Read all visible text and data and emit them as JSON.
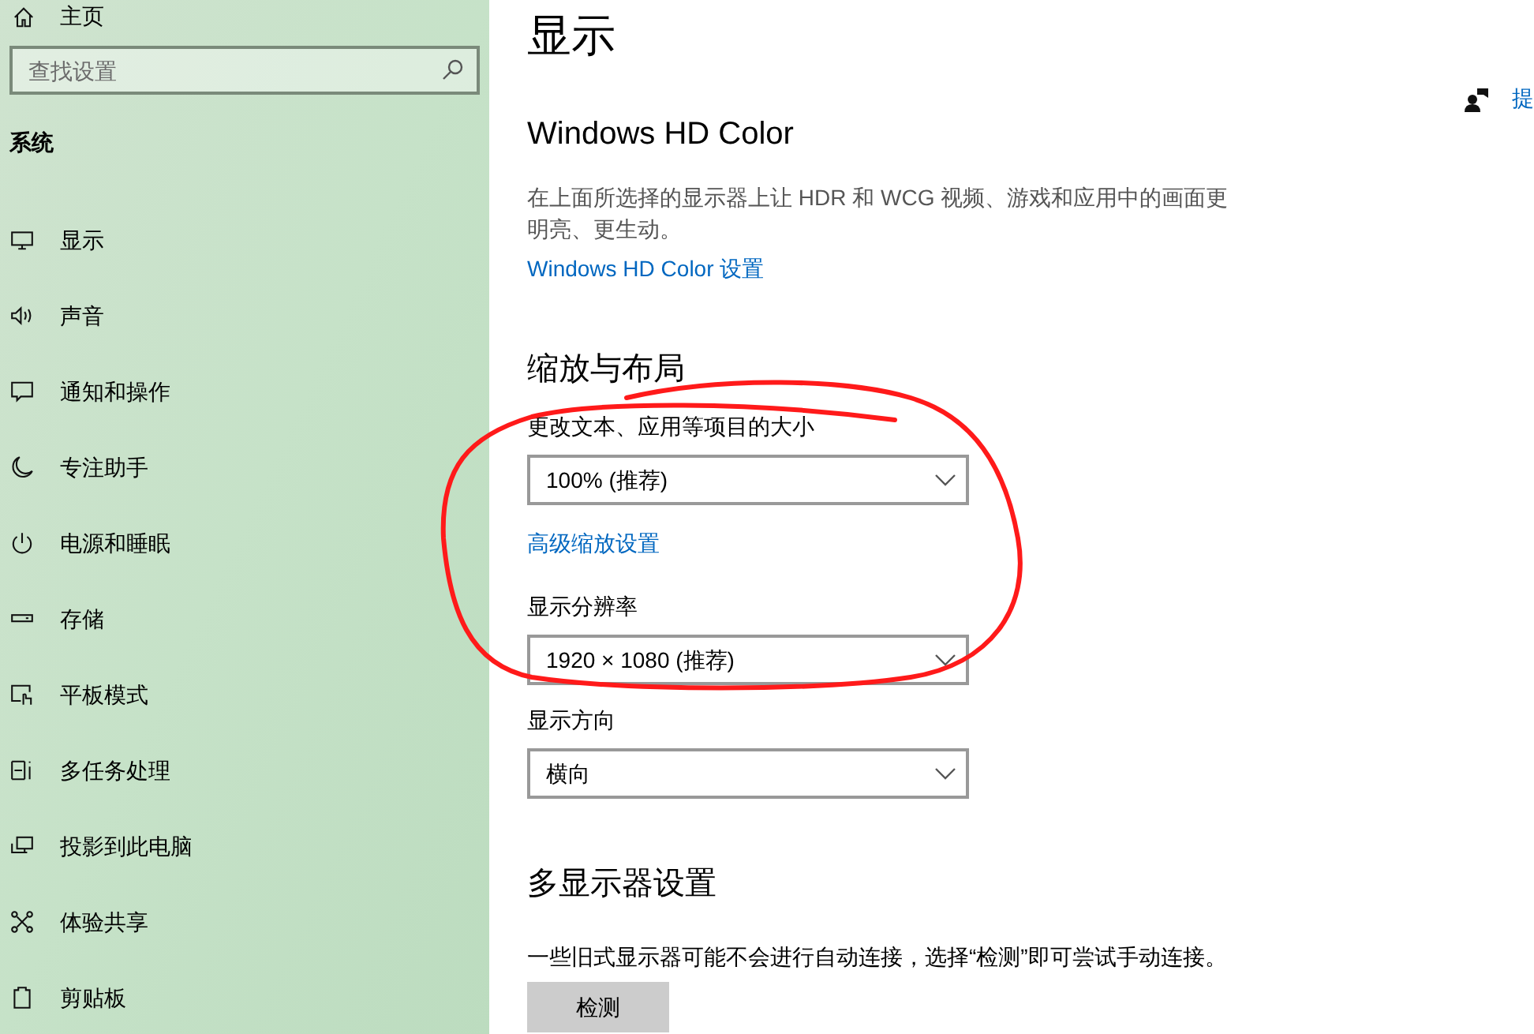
{
  "sidebar": {
    "home": "主页",
    "search": {
      "placeholder": "查找设置"
    },
    "section": "系统",
    "items": [
      {
        "label": "显示",
        "selected": false
      },
      {
        "label": "声音",
        "selected": false
      },
      {
        "label": "通知和操作",
        "selected": false
      },
      {
        "label": "专注助手",
        "selected": false
      },
      {
        "label": "电源和睡眠",
        "selected": false
      },
      {
        "label": "存储",
        "selected": false
      },
      {
        "label": "平板模式",
        "selected": false
      },
      {
        "label": "多任务处理",
        "selected": false
      },
      {
        "label": "投影到此电脑",
        "selected": false
      },
      {
        "label": "体验共享",
        "selected": false
      },
      {
        "label": "剪贴板",
        "selected": false
      }
    ]
  },
  "page": {
    "title": "显示",
    "help_link": "提",
    "hd_color": {
      "heading": "Windows HD Color",
      "description": "在上面所选择的显示器上让 HDR 和 WCG 视频、游戏和应用中的画面更明亮、更生动。",
      "link": "Windows HD Color 设置"
    },
    "scale_layout": {
      "heading": "缩放与布局",
      "fields": [
        {
          "kind": "dropdown",
          "label": "更改文本、应用等项目的大小",
          "value": "100% (推荐)"
        },
        {
          "kind": "link",
          "label": "高级缩放设置"
        },
        {
          "kind": "dropdown",
          "label": "显示分辨率",
          "value": "1920 × 1080 (推荐)"
        },
        {
          "kind": "dropdown",
          "label": "显示方向",
          "value": "横向"
        }
      ]
    },
    "multi_display": {
      "heading": "多显示器设置",
      "description": "一些旧式显示器可能不会进行自动连接，选择“检测”即可尝试手动连接。",
      "button": "检测"
    }
  }
}
